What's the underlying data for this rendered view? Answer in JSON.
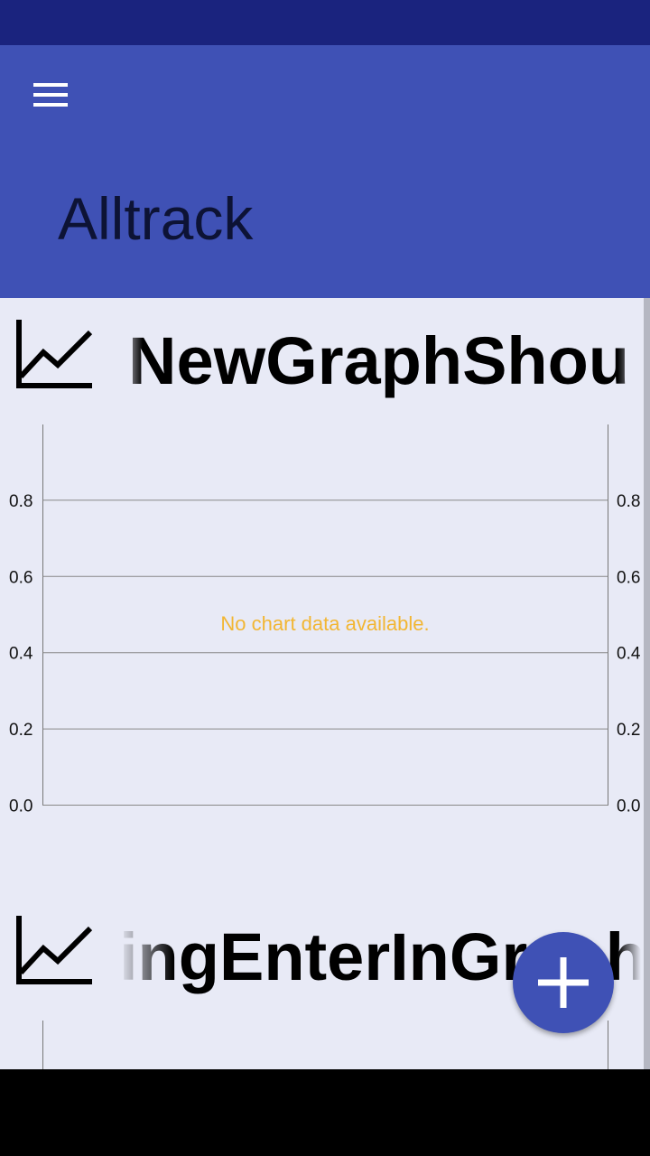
{
  "app": {
    "title": "Alltrack",
    "menu_icon": "hamburger-menu-icon",
    "colors": {
      "status_bar": "#1a237e",
      "primary": "#3f51b5",
      "background": "#e8eaf6",
      "empty_text": "#f2b633"
    }
  },
  "graphs": [
    {
      "name": "NewGraphShou",
      "icon": "line-chart-icon",
      "empty_message": "No chart data available.",
      "chart_data": {
        "type": "line",
        "series": [],
        "y_ticks_left": [
          "0.0",
          "0.2",
          "0.4",
          "0.6",
          "0.8"
        ],
        "y_ticks_right": [
          "0.0",
          "0.2",
          "0.4",
          "0.6",
          "0.8"
        ],
        "ylim": [
          0,
          1
        ],
        "grid": true
      }
    },
    {
      "name": "ingEnterInGraph",
      "icon": "line-chart-icon"
    }
  ],
  "fab": {
    "icon": "plus-icon",
    "color": "#3f51b5"
  }
}
